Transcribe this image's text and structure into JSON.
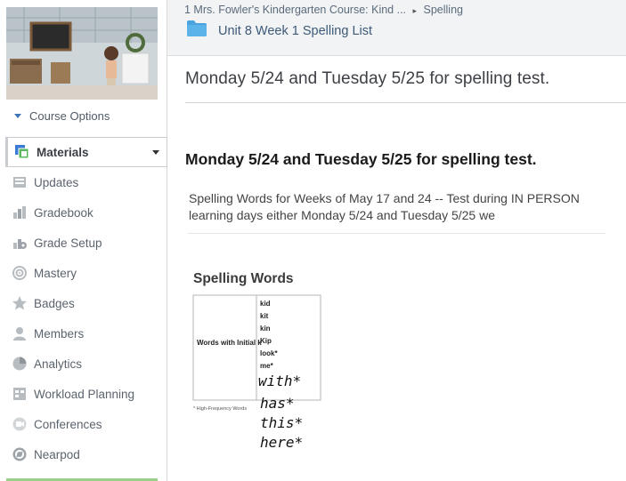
{
  "breadcrumb": {
    "course": "1 Mrs. Fowler's Kindergarten Course: Kind ...",
    "separator": "▸",
    "section": "Spelling"
  },
  "folder": {
    "title": "Unit 8 Week 1 Spelling List"
  },
  "sidebar": {
    "course_options_label": "Course Options",
    "items": [
      {
        "label": "Materials",
        "icon": "materials-icon",
        "active": true
      },
      {
        "label": "Updates",
        "icon": "updates-icon"
      },
      {
        "label": "Gradebook",
        "icon": "gradebook-icon"
      },
      {
        "label": "Grade Setup",
        "icon": "grade-setup-icon"
      },
      {
        "label": "Mastery",
        "icon": "mastery-icon"
      },
      {
        "label": "Badges",
        "icon": "badges-icon"
      },
      {
        "label": "Members",
        "icon": "members-icon"
      },
      {
        "label": "Analytics",
        "icon": "analytics-icon"
      },
      {
        "label": "Workload Planning",
        "icon": "workload-planning-icon"
      },
      {
        "label": "Conferences",
        "icon": "conferences-icon"
      },
      {
        "label": "Nearpod",
        "icon": "nearpod-icon"
      }
    ]
  },
  "page": {
    "title": "Monday 5/24 and Tuesday 5/25 for spelling test.",
    "heading": "Monday 5/24 and Tuesday 5/25 for spelling test.",
    "paragraph": "Spelling Words for Weeks of May 17 and 24 -- Test during IN PERSON learning days either Monday 5/24 and Tuesday 5/25 we"
  },
  "attachment": {
    "title": "Spelling Words",
    "row_label": "Words with Initial k",
    "printed_words": [
      "kid",
      "kit",
      "kin",
      "Kip",
      "look*",
      "me*"
    ],
    "handwritten_words": [
      "with*",
      "has*",
      "this*",
      "here*"
    ],
    "footnote": "* High-Frequency Words"
  },
  "colors": {
    "header_bg": "#f2f3f4",
    "link": "#3c5a78",
    "folder": "#4aa3df",
    "active_bar": "#9bd08a"
  }
}
